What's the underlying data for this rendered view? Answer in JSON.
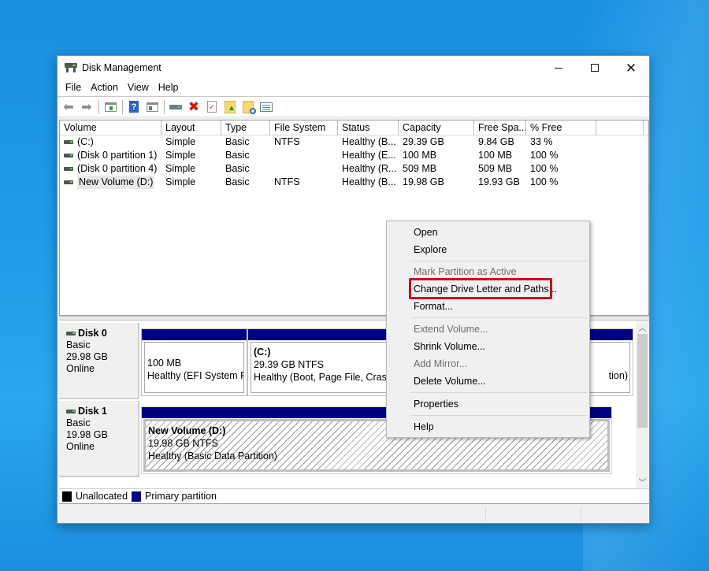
{
  "window": {
    "title": "Disk Management",
    "controls": {
      "minimize": "minimize",
      "maximize": "maximize",
      "close": "close"
    }
  },
  "menubar": [
    "File",
    "Action",
    "View",
    "Help"
  ],
  "toolbar": {
    "icons": [
      "back-icon",
      "forward-icon",
      "show-hide-console-tree-icon",
      "help-icon",
      "show-hide-action-pane-icon",
      "connect-disk-icon",
      "delete-icon",
      "properties-checklist-icon",
      "folder-up-icon",
      "folder-search-icon",
      "list-view-icon"
    ]
  },
  "volume_list": {
    "columns": [
      "Volume",
      "Layout",
      "Type",
      "File System",
      "Status",
      "Capacity",
      "Free Spa...",
      "% Free",
      ""
    ],
    "rows": [
      {
        "volume": " (C:)",
        "layout": "Simple",
        "type": "Basic",
        "fs": "NTFS",
        "status": "Healthy (B...",
        "capacity": "29.39 GB",
        "free": "9.84 GB",
        "pct_free": "33 %"
      },
      {
        "volume": "(Disk 0 partition 1)",
        "layout": "Simple",
        "type": "Basic",
        "fs": "",
        "status": "Healthy (E...",
        "capacity": "100 MB",
        "free": "100 MB",
        "pct_free": "100 %"
      },
      {
        "volume": "(Disk 0 partition 4)",
        "layout": "Simple",
        "type": "Basic",
        "fs": "",
        "status": "Healthy (R...",
        "capacity": "509 MB",
        "free": "509 MB",
        "pct_free": "100 %"
      },
      {
        "volume": "New Volume (D:)",
        "layout": "Simple",
        "type": "Basic",
        "fs": "NTFS",
        "status": "Healthy (B...",
        "capacity": "19.98 GB",
        "free": "19.93 GB",
        "pct_free": "100 %"
      }
    ]
  },
  "disks": [
    {
      "name": "Disk 0",
      "type": "Basic",
      "size": "29.98 GB",
      "state": "Online",
      "partitions": [
        {
          "title": "",
          "line1": "100 MB",
          "line2": "Healthy (EFI System Pa"
        },
        {
          "title": "(C:)",
          "line1": "29.39 GB NTFS",
          "line2": "Healthy (Boot, Page File, Crash D"
        },
        {
          "title": "",
          "line1": "",
          "line2": "tion)"
        }
      ]
    },
    {
      "name": "Disk 1",
      "type": "Basic",
      "size": "19.98 GB",
      "state": "Online",
      "partitions": [
        {
          "title": "New Volume  (D:)",
          "line1": "19.98 GB NTFS",
          "line2": "Healthy (Basic Data Partition)"
        }
      ]
    }
  ],
  "legend": [
    {
      "label": "Unallocated",
      "color": "#000000"
    },
    {
      "label": "Primary partition",
      "color": "#000080"
    }
  ],
  "context_menu": {
    "items": [
      {
        "label": "Open",
        "enabled": true
      },
      {
        "label": "Explore",
        "enabled": true
      },
      {
        "label": "Mark Partition as Active",
        "enabled": false
      },
      {
        "label": "Change Drive Letter and Paths...",
        "enabled": true,
        "highlighted": true
      },
      {
        "label": "Format...",
        "enabled": true
      },
      {
        "label": "Extend Volume...",
        "enabled": false
      },
      {
        "label": "Shrink Volume...",
        "enabled": true
      },
      {
        "label": "Add Mirror...",
        "enabled": false
      },
      {
        "label": "Delete Volume...",
        "enabled": true
      },
      {
        "label": "Properties",
        "enabled": true
      },
      {
        "label": "Help",
        "enabled": true
      }
    ]
  },
  "colors": {
    "partition_bar": "#000080",
    "highlight_border": "#c8101e",
    "desktop_blue": "#1e9be8"
  }
}
